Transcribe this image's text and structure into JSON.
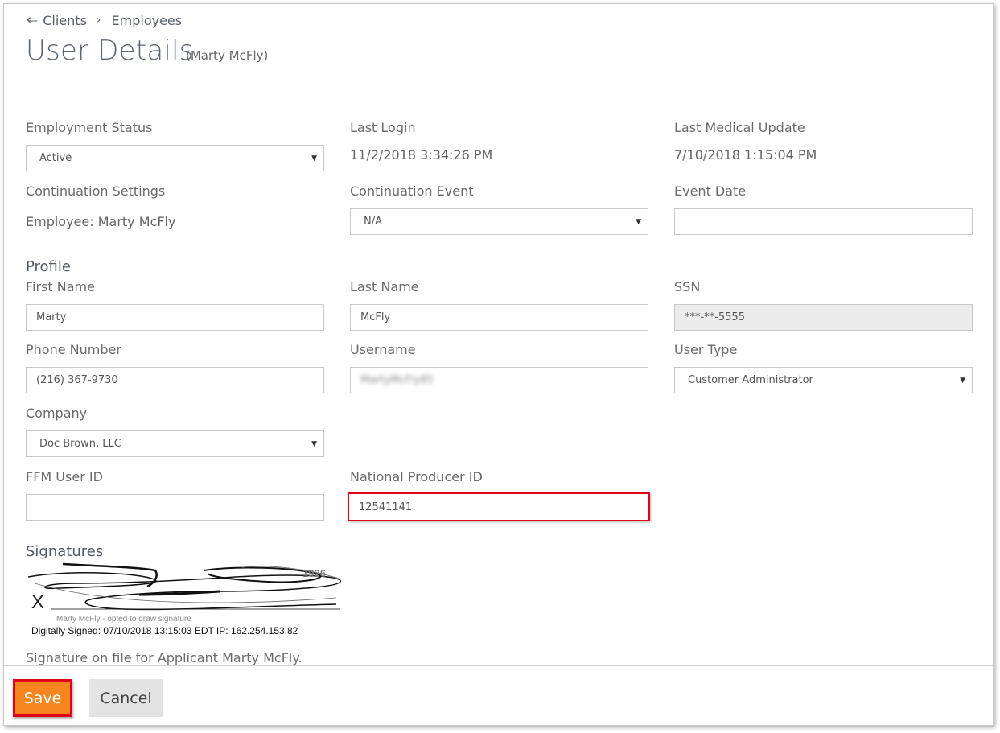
{
  "breadcrumb": {
    "back_icon": "back-arrow-icon",
    "clients": "Clients",
    "separator_icon": "chevron-right-icon",
    "employees": "Employees"
  },
  "page": {
    "title": "User Details",
    "subtitle": "(Marty McFly)"
  },
  "employment": {
    "status_label": "Employment Status",
    "status_value": "Active",
    "last_login_label": "Last Login",
    "last_login_value": "11/2/2018 3:34:26 PM",
    "last_medical_label": "Last Medical Update",
    "last_medical_value": "7/10/2018 1:15:04 PM",
    "continuation_settings_label": "Continuation Settings",
    "continuation_settings_value": "Employee: Marty McFly",
    "continuation_event_label": "Continuation Event",
    "continuation_event_value": "N/A",
    "event_date_label": "Event Date",
    "event_date_value": ""
  },
  "profile": {
    "heading": "Profile",
    "first_name_label": "First Name",
    "first_name_value": "Marty",
    "last_name_label": "Last Name",
    "last_name_value": "McFly",
    "ssn_label": "SSN",
    "ssn_value": "***-**-5555",
    "phone_label": "Phone Number",
    "phone_value": "(216) 367-9730",
    "username_label": "Username",
    "username_value": "MartyMcFly85",
    "user_type_label": "User Type",
    "user_type_value": "Customer Administrator",
    "company_label": "Company",
    "company_value": "Doc Brown, LLC",
    "ffm_label": "FFM User ID",
    "ffm_value": "",
    "npn_label": "National Producer ID",
    "npn_value": "12541141"
  },
  "signatures": {
    "heading": "Signatures",
    "x_mark": "X",
    "year_mark": "1926",
    "caption": "Marty McFly - opted to draw signature",
    "signed_line": "Digitally Signed: 07/10/2018 13:15:03 EDT IP:  162.254.153.82",
    "note": "Signature on file for Applicant Marty McFly."
  },
  "actions": {
    "save": "Save",
    "cancel": "Cancel"
  },
  "colors": {
    "save": "#f6851f",
    "highlight": "#e0001b",
    "title": "#5b6776"
  }
}
